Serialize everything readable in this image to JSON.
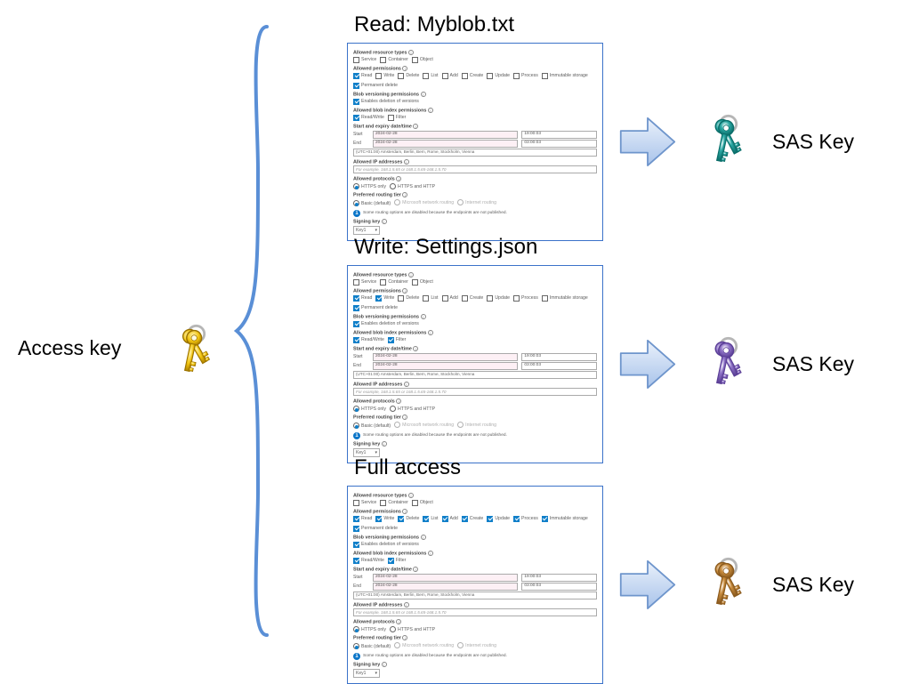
{
  "accessKeyLabel": "Access key",
  "sasKeyLabel": "SAS Key",
  "rows": {
    "0": {
      "title": "Read: Myblob.txt"
    },
    "1": {
      "title": "Write: Settings.json"
    },
    "2": {
      "title": "Full access"
    }
  },
  "form": {
    "resourceTypes": {
      "label": "Allowed resource types",
      "service": "Service",
      "container": "Container",
      "object": "Object"
    },
    "permissions": {
      "label": "Allowed permissions",
      "read": "Read",
      "write": "Write",
      "delete": "Delete",
      "list": "List",
      "add": "Add",
      "create": "Create",
      "update": "Update",
      "process": "Process",
      "immutable": "Immutable storage",
      "permDelete": "Permanent delete"
    },
    "blobVersioning": {
      "label": "Blob versioning permissions",
      "enable": "Enables deletion of versions"
    },
    "blobIndex": {
      "label": "Allowed blob index permissions",
      "rw": "Read/Write",
      "filter": "Filter"
    },
    "datetime": {
      "label": "Start and expiry date/time",
      "start": "Start",
      "end": "End",
      "startDate": "2024-02-28",
      "endDate": "2024-02-28",
      "startTime": "19:00:03",
      "endTime": "03:00:03",
      "tz": "(UTC+01:00) Amsterdam, Berlin, Bern, Rome, Stockholm, Vienna"
    },
    "ip": {
      "label": "Allowed IP addresses",
      "placeholder": "For example, 168.1.5.65 or 168.1.5.65-168.1.5.70"
    },
    "protocols": {
      "label": "Allowed protocols",
      "httpsOnly": "HTTPS only",
      "both": "HTTPS and HTTP"
    },
    "routing": {
      "label": "Preferred routing tier",
      "basic": "Basic (default)",
      "msNet": "Microsoft network routing",
      "inet": "Internet routing",
      "info": "Some routing options are disabled because the endpoints are not published."
    },
    "signing": {
      "label": "Signing key",
      "value": "Key1"
    }
  },
  "panelChecks": {
    "read": {
      "perms": {
        "read": true,
        "write": false,
        "delete": false,
        "list": false,
        "add": false,
        "create": false,
        "update": false,
        "process": false,
        "immutable": false,
        "permDelete": true
      },
      "versioning": true,
      "blobIndex": {
        "rw": true,
        "filter": false
      }
    },
    "write": {
      "perms": {
        "read": true,
        "write": true,
        "delete": false,
        "list": false,
        "add": false,
        "create": false,
        "update": false,
        "process": false,
        "immutable": false,
        "permDelete": true
      },
      "versioning": true,
      "blobIndex": {
        "rw": true,
        "filter": true
      }
    },
    "full": {
      "perms": {
        "read": true,
        "write": true,
        "delete": true,
        "list": true,
        "add": true,
        "create": true,
        "update": true,
        "process": true,
        "immutable": true,
        "permDelete": true
      },
      "versioning": true,
      "blobIndex": {
        "rw": true,
        "filter": true
      }
    }
  },
  "icons": {
    "accessKeyColor": "#e4b500",
    "sasKeyColors": {
      "0": "#29a7a2",
      "1": "#8e72c7",
      "2": "#c88b3c"
    }
  }
}
